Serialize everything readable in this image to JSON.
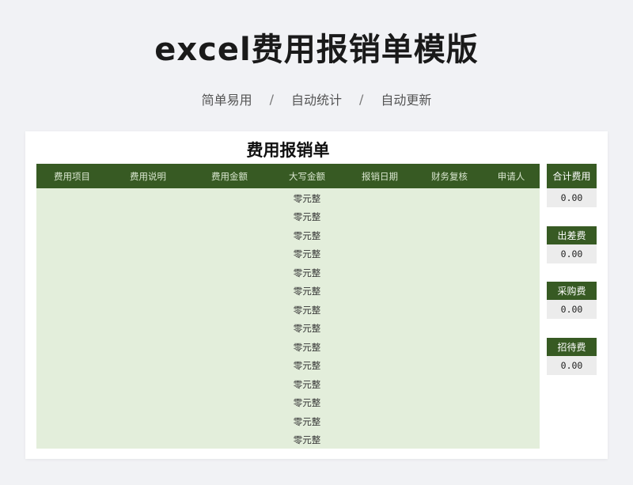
{
  "header": {
    "title": "excel费用报销单模版",
    "features": [
      "简单易用",
      "自动统计",
      "自动更新"
    ],
    "separator": "/"
  },
  "sheet": {
    "title": "费用报销单",
    "columns": [
      "费用项目",
      "费用说明",
      "费用金额",
      "大写金额",
      "报销日期",
      "财务复核",
      "申请人"
    ],
    "rows": [
      {
        "amount_upper": "零元整"
      },
      {
        "amount_upper": "零元整"
      },
      {
        "amount_upper": "零元整"
      },
      {
        "amount_upper": "零元整"
      },
      {
        "amount_upper": "零元整"
      },
      {
        "amount_upper": "零元整"
      },
      {
        "amount_upper": "零元整"
      },
      {
        "amount_upper": "零元整"
      },
      {
        "amount_upper": "零元整"
      },
      {
        "amount_upper": "零元整"
      },
      {
        "amount_upper": "零元整"
      },
      {
        "amount_upper": "零元整"
      },
      {
        "amount_upper": "零元整"
      },
      {
        "amount_upper": "零元整"
      }
    ]
  },
  "summary": [
    {
      "label": "合计费用",
      "value": "0.00"
    },
    {
      "label": "出差费",
      "value": "0.00"
    },
    {
      "label": "采购费",
      "value": "0.00"
    },
    {
      "label": "招待费",
      "value": "0.00"
    }
  ],
  "colors": {
    "header_green": "#375a23",
    "body_green": "#e3eedb",
    "value_gray": "#ececec"
  }
}
